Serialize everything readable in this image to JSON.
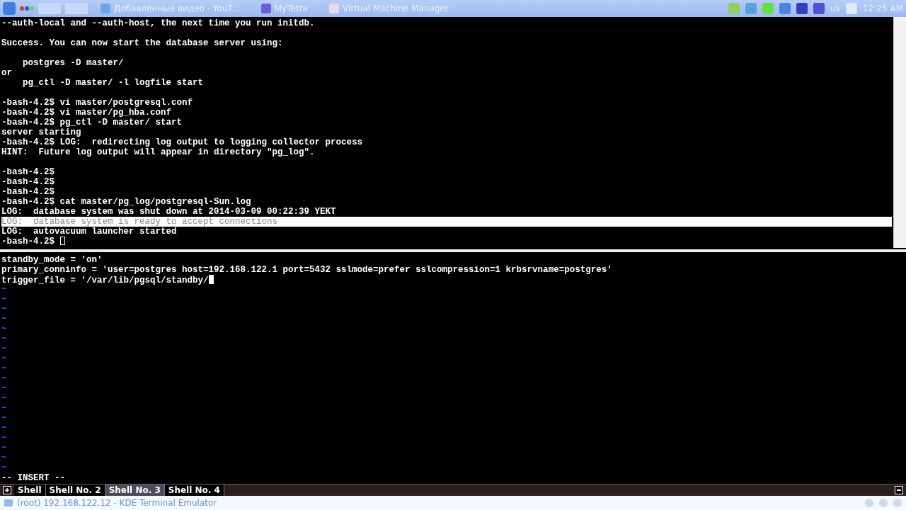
{
  "taskbar": {
    "tasks": [
      {
        "title": "Добавленные видео - YouT...",
        "kind": "browser"
      },
      {
        "title": "MyTetra",
        "kind": "app"
      },
      {
        "title": "Virtual Machine Manager",
        "kind": "vm"
      }
    ],
    "keyboard_layout": "us",
    "clock": "12:25 AM"
  },
  "top_pane": {
    "lines": [
      {
        "text": "--auth-local and --auth-host, the next time you run initdb.",
        "selected": false
      },
      {
        "kind": "blank"
      },
      {
        "text": "Success. You can now start the database server using:",
        "selected": false
      },
      {
        "kind": "blank"
      },
      {
        "text": "    postgres -D master/",
        "selected": false
      },
      {
        "text": "or",
        "selected": false
      },
      {
        "text": "    pg_ctl -D master/ -l logfile start",
        "selected": false
      },
      {
        "kind": "blank"
      },
      {
        "text": "-bash-4.2$ vi master/postgresql.conf",
        "selected": false
      },
      {
        "text": "-bash-4.2$ vi master/pg_hba.conf",
        "selected": false
      },
      {
        "text": "-bash-4.2$ pg_ctl -D master/ start",
        "selected": false
      },
      {
        "text": "server starting",
        "selected": false
      },
      {
        "text": "-bash-4.2$ LOG:  redirecting log output to logging collector process",
        "selected": false
      },
      {
        "text": "HINT:  Future log output will appear in directory \"pg_log\".",
        "selected": false
      },
      {
        "kind": "blank"
      },
      {
        "text": "-bash-4.2$",
        "selected": false
      },
      {
        "text": "-bash-4.2$",
        "selected": false
      },
      {
        "text": "-bash-4.2$",
        "selected": false
      },
      {
        "text": "-bash-4.2$ cat master/pg_log/postgresql-Sun.log",
        "selected": false
      },
      {
        "text": "LOG:  database system was shut down at 2014-03-09 00:22:39 YEKT",
        "selected": false
      },
      {
        "text": "LOG:  database system is ready to accept connections",
        "selected": true
      },
      {
        "text": "LOG:  autovacuum launcher started",
        "selected": false
      },
      {
        "text": "-bash-4.2$ ",
        "selected": false,
        "cursor": true
      }
    ],
    "focused": false
  },
  "bottom_pane": {
    "lines": [
      {
        "text": "standby_mode = 'on'"
      },
      {
        "text": "primary_conninfo = 'user=postgres host=192.168.122.1 port=5432 sslmode=prefer sslcompression=1 krbsrvname=postgres'"
      },
      {
        "text": "trigger_file = '/var/lib/pgsql/standby/",
        "cursor": true
      }
    ],
    "focused": true,
    "empty_markers": [
      "~",
      "~",
      "~",
      "~",
      "~",
      "~",
      "~",
      "~",
      "~",
      "~",
      "~",
      "~",
      "~",
      "~",
      "~",
      "~",
      "~",
      "~",
      "~"
    ],
    "mode": "-- INSERT --"
  },
  "tabs": [
    {
      "label": "Shell",
      "selected": false
    },
    {
      "label": "Shell No. 2",
      "selected": false
    },
    {
      "label": "Shell No. 3",
      "selected": true
    },
    {
      "label": "Shell No. 4",
      "selected": false
    }
  ],
  "window": {
    "title": "(root) 192.168.122.12 - KDE Terminal Emulator"
  }
}
